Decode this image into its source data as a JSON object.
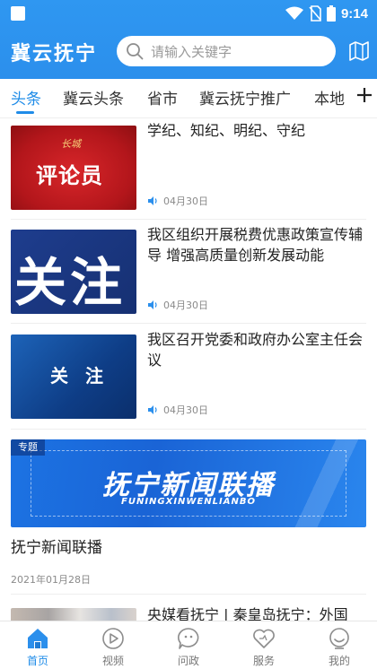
{
  "status_bar": {
    "time": "9:14"
  },
  "header": {
    "app_title": "冀云抚宁",
    "search_placeholder": "请输入关键字",
    "map_icon": "map-icon"
  },
  "tabs": [
    {
      "label": "头条",
      "active": true
    },
    {
      "label": "冀云头条",
      "active": false
    },
    {
      "label": "省市",
      "active": false
    },
    {
      "label": "冀云抚宁推广",
      "active": false
    },
    {
      "label": "本地",
      "active": false
    }
  ],
  "news": [
    {
      "title": "学纪、知纪、明纪、守纪",
      "date": "04月30日",
      "thumb_brand": "长城",
      "thumb_text": "评论员",
      "audio_icon": "speaker-icon"
    },
    {
      "title": "我区组织开展税费优惠政策宣传辅导 增强高质量创新发展动能",
      "date": "04月30日",
      "thumb_text": "关注",
      "audio_icon": "speaker-icon"
    },
    {
      "title": "我区召开党委和政府办公室主任会议",
      "date": "04月30日",
      "thumb_text": "关 注",
      "audio_icon": "speaker-icon"
    }
  ],
  "special": {
    "tag": "专题",
    "banner_title": "抚宁新闻联播",
    "banner_subtitle": "FUNINGXINWENLIANBO",
    "title": "抚宁新闻联播",
    "date": "2021年01月28日"
  },
  "partial_news": {
    "title": "央媒看抚宁 | 秦皇岛抚宁：外国"
  },
  "bottom_nav": [
    {
      "label": "首页",
      "icon": "home-icon",
      "active": true
    },
    {
      "label": "视频",
      "icon": "play-icon",
      "active": false
    },
    {
      "label": "问政",
      "icon": "chat-icon",
      "active": false
    },
    {
      "label": "服务",
      "icon": "heart-icon",
      "active": false
    },
    {
      "label": "我的",
      "icon": "user-icon",
      "active": false
    }
  ],
  "colors": {
    "brand_blue": "#2f97f1",
    "active_blue": "#1f8ce8"
  }
}
